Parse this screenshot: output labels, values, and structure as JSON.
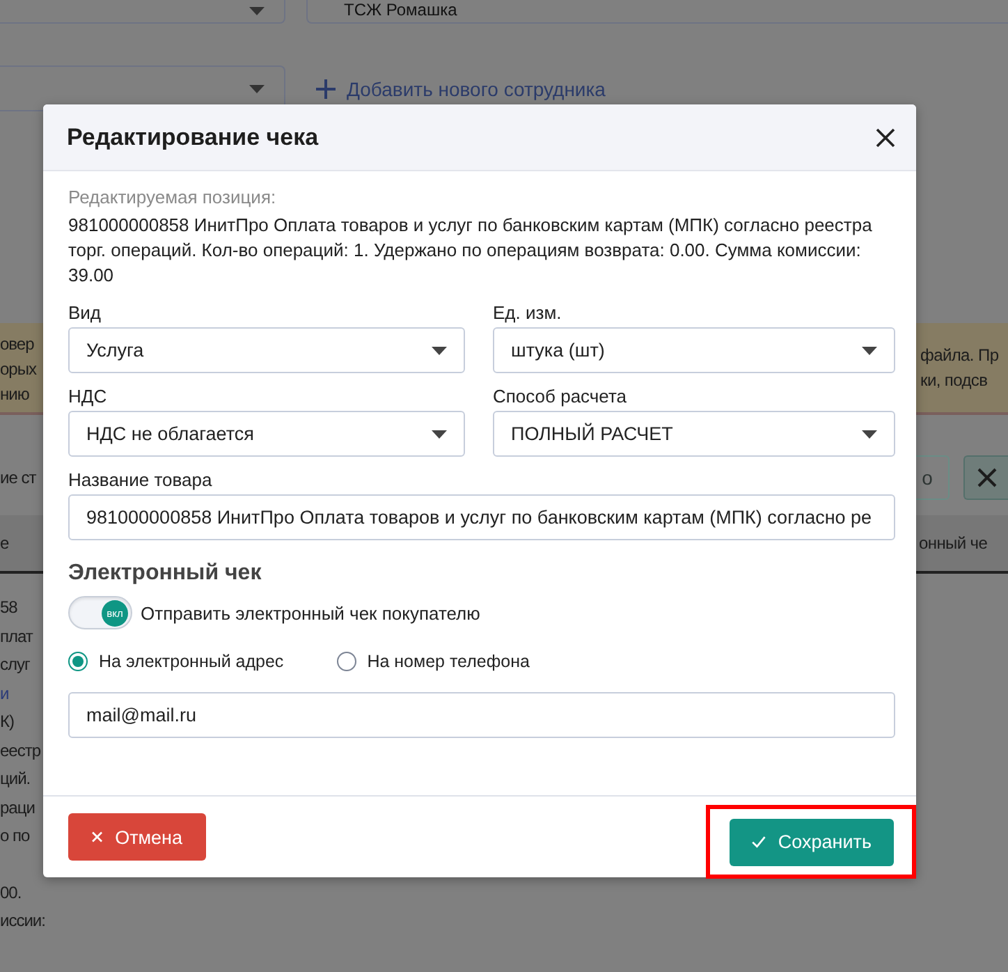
{
  "background": {
    "organization_field": {
      "value": "ТСЖ Ромашка"
    },
    "add_employee_link": "Добавить нового сотрудника",
    "notice_left_lines": [
      "овер",
      "орых",
      "нию"
    ],
    "notice_right_lines": [
      "файла. Пр",
      "ки, подсв"
    ],
    "toolbar_left_text": "ие ст",
    "toolbar_right_button": "о",
    "table_header_left": "е",
    "table_header_right": "онный че",
    "left_column_lines": [
      {
        "text": "58",
        "kind": "text"
      },
      {
        "text": "плат",
        "kind": "text"
      },
      {
        "text": "слуг",
        "kind": "text"
      },
      {
        "text": "и",
        "kind": "link"
      },
      {
        "text": "К)",
        "kind": "text"
      },
      {
        "text": "еестр",
        "kind": "text"
      },
      {
        "text": "ций.",
        "kind": "text"
      },
      {
        "text": "раци",
        "kind": "text"
      },
      {
        "text": "о по",
        "kind": "text"
      }
    ],
    "left_column_footer_lines": [
      "00.",
      "иссии:"
    ]
  },
  "dialog": {
    "title": "Редактирование чека",
    "position_label": "Редактируемая позиция:",
    "position_text": "981000000858 ИнитПро Оплата товаров и услуг по банковским картам (МПК) согласно реестра торг. операций. Кол-во операций: 1. Удержано по операциям возврата: 0.00. Сумма комиссии: 39.00",
    "fields": [
      {
        "label": "Вид",
        "kind": "select",
        "value": "Услуга"
      },
      {
        "label": "Ед. изм.",
        "kind": "select",
        "value": "штука (шт)"
      },
      {
        "label": "НДС",
        "kind": "select",
        "value": "НДС не облагается"
      },
      {
        "label": "Способ расчета",
        "kind": "select",
        "value": "ПОЛНЫЙ РАСЧЕТ"
      },
      {
        "label": "Название товара",
        "kind": "text",
        "value": "981000000858 ИнитПро Оплата товаров и услуг по банковским картам (МПК) согласно ре"
      }
    ],
    "receipt": {
      "heading": "Электронный чек",
      "toggle": {
        "on": true,
        "knob_label": "вкл",
        "label": "Отправить электронный чек покупателю"
      },
      "delivery_options": [
        {
          "label": "На электронный адрес",
          "selected": true
        },
        {
          "label": "На номер телефона",
          "selected": false
        }
      ],
      "email": {
        "value": "mail@mail.ru"
      }
    },
    "buttons": [
      {
        "kind": "cancel",
        "label": "Отмена",
        "highlighted": false
      },
      {
        "kind": "save",
        "label": "Сохранить",
        "highlighted": true
      }
    ]
  }
}
